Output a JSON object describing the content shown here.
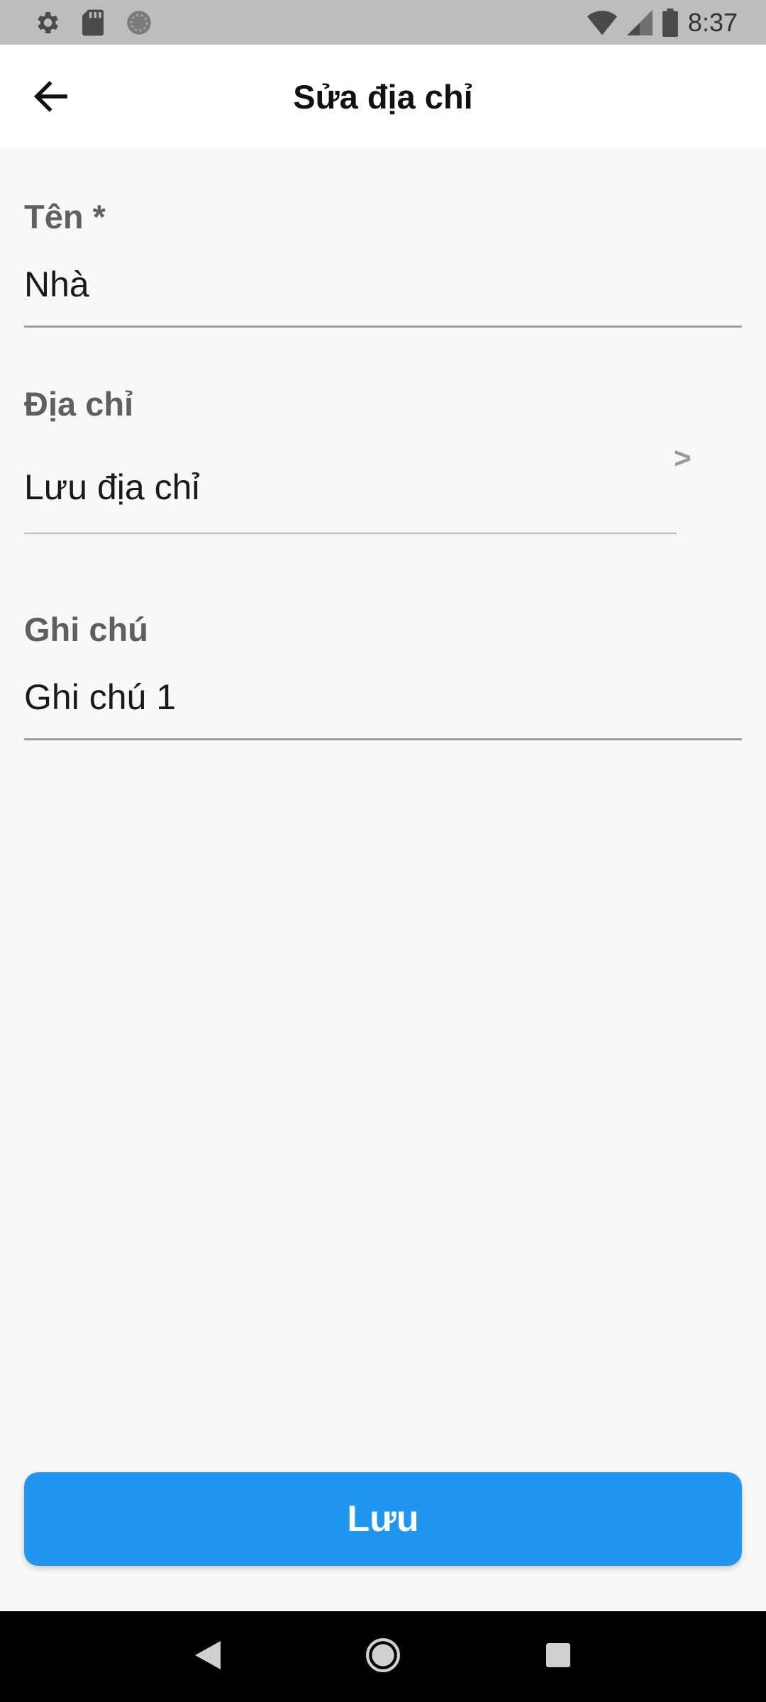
{
  "status_bar": {
    "time": "8:37",
    "icons": [
      "settings-icon",
      "sd-card-icon",
      "sync-icon",
      "wifi-icon",
      "signal-icon",
      "battery-icon"
    ]
  },
  "app_bar": {
    "title": "Sửa địa chỉ",
    "back_icon": "arrow-left-icon"
  },
  "form": {
    "name": {
      "label": "Tên *",
      "value": "Nhà"
    },
    "address": {
      "label": "Địa chỉ",
      "value": "Lưu địa chỉ",
      "chevron": ">"
    },
    "note": {
      "label": "Ghi chú",
      "value": "Ghi chú 1"
    }
  },
  "save_button": {
    "label": "Lưu"
  },
  "colors": {
    "primary": "#2196f0",
    "status_bar": "#bdbdbd",
    "background": "#f8f8f8",
    "label": "#5f5f5f",
    "nav_bar": "#000000"
  },
  "nav_bar": {
    "icons": [
      "back-triangle-icon",
      "home-circle-icon",
      "recents-square-icon"
    ]
  }
}
